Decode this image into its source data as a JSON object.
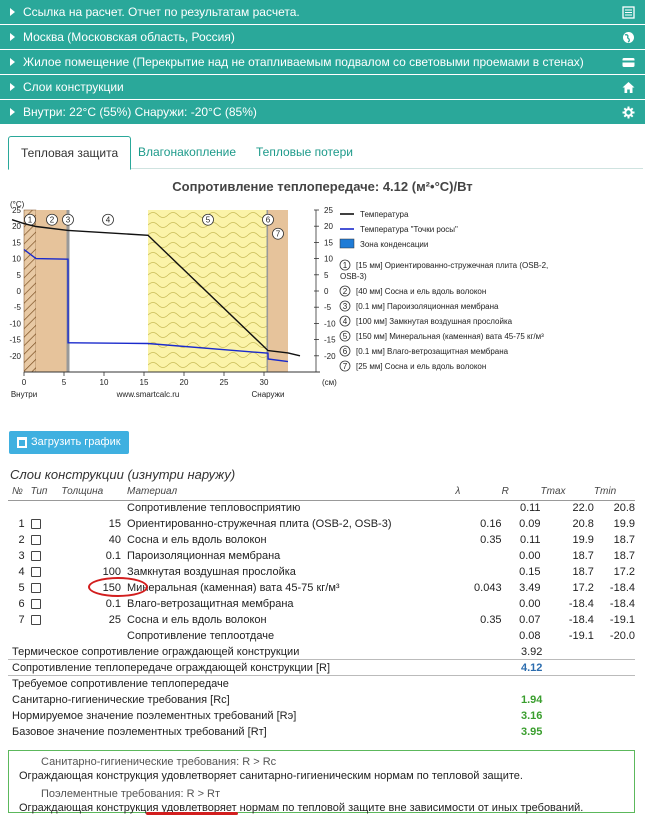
{
  "accordion": [
    {
      "label": "Ссылка на расчет. Отчет по результатам расчета.",
      "icon": "list-icon"
    },
    {
      "label": "Москва (Московская область, Россия)",
      "icon": "globe-icon"
    },
    {
      "label": "Жилое помещение (Перекрытие над не отапливаемым подвалом со световыми проемами в стенах)",
      "icon": "card-icon"
    },
    {
      "label": "Слои конструкции",
      "icon": "home-icon"
    },
    {
      "label": "Внутри: 22°C (55%) Снаружи: -20°C (85%)",
      "icon": "gear-icon"
    }
  ],
  "tabs": [
    "Тепловая защита",
    "Влагонакопление",
    "Тепловые потери"
  ],
  "chart_title": "Сопротивление теплопередаче: 4.12 (м²•°C)/Вт",
  "chart_data": {
    "type": "line",
    "ylabel": "(°C)",
    "xlabel": "(см)",
    "x_axis_label_left": "Внутри",
    "x_axis_label_mid": "www.smartcalc.ru",
    "x_axis_label_right": "Снаружи",
    "xlim": [
      0,
      35
    ],
    "ylim": [
      -25,
      25
    ],
    "x_ticks": [
      0,
      5,
      10,
      15,
      20,
      25,
      30
    ],
    "y_ticks": [
      25,
      20,
      15,
      10,
      5,
      0,
      -5,
      -10,
      -15,
      -20
    ],
    "layer_bounds_cm": [
      0,
      1.5,
      5.5,
      5.51,
      15.5,
      30.5,
      30.51,
      33
    ],
    "layer_numbers": [
      "1",
      "2",
      "3",
      "4",
      "5",
      "6",
      "7"
    ],
    "layer_label_x_cm": [
      0.75,
      3.5,
      5.5,
      10.5,
      23,
      30.5,
      31.75
    ],
    "series": [
      {
        "name": "Температура",
        "color": "#111111",
        "x": [
          -1.5,
          0,
          1.5,
          5.5,
          5.51,
          15.5,
          30.5,
          30.51,
          33,
          34.5
        ],
        "y": [
          22,
          20.8,
          19.9,
          18.7,
          18.7,
          17.2,
          -18.4,
          -18.4,
          -19.1,
          -20
        ]
      },
      {
        "name": "Температура \"Точки росы\"",
        "color": "#1a2acc",
        "x": [
          0,
          1.5,
          5.5,
          5.51,
          6,
          15.5,
          30.5,
          30.51,
          33
        ],
        "y": [
          12.8,
          10.0,
          9.8,
          -16.0,
          -16.0,
          -16.2,
          -19.2,
          -21.0,
          -21.8
        ]
      }
    ],
    "legend": [
      {
        "label": "Температура",
        "kind": "line",
        "color": "#111111"
      },
      {
        "label": "Температура \"Точки росы\"",
        "kind": "line",
        "color": "#1a2acc"
      },
      {
        "label": "Зона конденсации",
        "kind": "box",
        "color": "#1e7bd6"
      }
    ],
    "layers_legend": [
      {
        "n": "1",
        "text": "[15 мм] Ориентированно-стружечная плита (OSB-2,",
        "text2": "OSB-3)"
      },
      {
        "n": "2",
        "text": "[40 мм] Сосна и ель вдоль волокон"
      },
      {
        "n": "3",
        "text": "[0.1 мм] Пароизоляционная мембрана"
      },
      {
        "n": "4",
        "text": "[100 мм] Замкнутая воздушная прослойка"
      },
      {
        "n": "5",
        "text": "[150 мм] Минеральная (каменная) вата 45-75 кг/м³"
      },
      {
        "n": "6",
        "text": "[0.1 мм] Влаго-ветрозащитная мембрана"
      },
      {
        "n": "7",
        "text": "[25 мм] Сосна и ель вдоль волокон"
      }
    ]
  },
  "download_button": "Загрузить график",
  "layers_title": "Слои конструкции (изнутри наружу)",
  "table": {
    "headers": [
      "№",
      "Тип",
      "Толщина",
      "Материал",
      "λ",
      "R",
      "Tmax",
      "Tmin"
    ],
    "top_row": {
      "material": "Сопротивление тепловосприятию",
      "r": "0.11",
      "tmax": "22.0",
      "tmin": "20.8"
    },
    "rows": [
      {
        "n": "1",
        "thick": "15",
        "material": "Ориентированно-стружечная плита (OSB-2, OSB-3)",
        "lambda": "0.16",
        "r": "0.09",
        "tmax": "20.8",
        "tmin": "19.9"
      },
      {
        "n": "2",
        "thick": "40",
        "material": "Сосна и ель вдоль волокон",
        "lambda": "0.35",
        "r": "0.11",
        "tmax": "19.9",
        "tmin": "18.7"
      },
      {
        "n": "3",
        "thick": "0.1",
        "material": "Пароизоляционная мембрана",
        "lambda": "",
        "r": "0.00",
        "tmax": "18.7",
        "tmin": "18.7"
      },
      {
        "n": "4",
        "thick": "100",
        "material": "Замкнутая воздушная прослойка",
        "lambda": "",
        "r": "0.15",
        "tmax": "18.7",
        "tmin": "17.2"
      },
      {
        "n": "5",
        "thick": "150",
        "material": "Минеральная (каменная) вата 45-75 кг/м³",
        "lambda": "0.043",
        "r": "3.49",
        "tmax": "17.2",
        "tmin": "-18.4"
      },
      {
        "n": "6",
        "thick": "0.1",
        "material": "Влаго-ветрозащитная мембрана",
        "lambda": "",
        "r": "0.00",
        "tmax": "-18.4",
        "tmin": "-18.4"
      },
      {
        "n": "7",
        "thick": "25",
        "material": "Сосна и ель вдоль волокон",
        "lambda": "0.35",
        "r": "0.07",
        "tmax": "-18.4",
        "tmin": "-19.1"
      }
    ],
    "bottom_row": {
      "material": "Сопротивление теплоотдаче",
      "r": "0.08",
      "tmax": "-19.1",
      "tmin": "-20.0"
    }
  },
  "summary": {
    "thermal_label": "Термическое сопротивление ограждающей конструкции",
    "thermal_value": "3.92",
    "total_label": "Сопротивление теплопередаче ограждающей конструкции [R]",
    "total_value": "4.12",
    "required_label": "Требуемое сопротивление теплопередаче",
    "sanit_label": "Санитарно-гигиенические требования [Rc]",
    "sanit_value": "1.94",
    "norm_label": "Нормируемое значение поэлементных требований [Rэ]",
    "norm_value": "3.16",
    "base_label": "Базовое значение поэлементных требований [Rт]",
    "base_value": "3.95"
  },
  "results": {
    "sanit_heading": "Санитарно-гигиенические требования: R > Rc",
    "sanit_text": "Ограждающая конструкция удовлетворяет санитарно-гигиеническим нормам по тепловой защите.",
    "elem_heading": "Поэлементные требования: R > Rт",
    "elem_text": "Ограждающая конструкция удовлетворяет нормам по тепловой защите вне зависимости от иных требований."
  }
}
